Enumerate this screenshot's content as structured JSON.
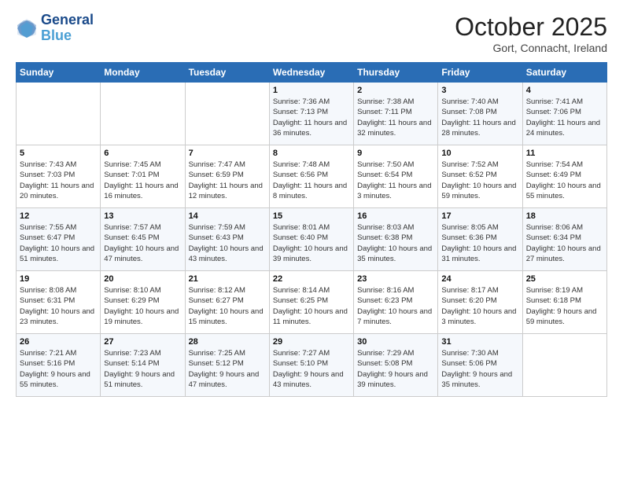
{
  "header": {
    "logo_line1": "General",
    "logo_line2": "Blue",
    "month_title": "October 2025",
    "location": "Gort, Connacht, Ireland"
  },
  "days_of_week": [
    "Sunday",
    "Monday",
    "Tuesday",
    "Wednesday",
    "Thursday",
    "Friday",
    "Saturday"
  ],
  "weeks": [
    [
      {
        "num": "",
        "info": ""
      },
      {
        "num": "",
        "info": ""
      },
      {
        "num": "",
        "info": ""
      },
      {
        "num": "1",
        "info": "Sunrise: 7:36 AM\nSunset: 7:13 PM\nDaylight: 11 hours\nand 36 minutes."
      },
      {
        "num": "2",
        "info": "Sunrise: 7:38 AM\nSunset: 7:11 PM\nDaylight: 11 hours\nand 32 minutes."
      },
      {
        "num": "3",
        "info": "Sunrise: 7:40 AM\nSunset: 7:08 PM\nDaylight: 11 hours\nand 28 minutes."
      },
      {
        "num": "4",
        "info": "Sunrise: 7:41 AM\nSunset: 7:06 PM\nDaylight: 11 hours\nand 24 minutes."
      }
    ],
    [
      {
        "num": "5",
        "info": "Sunrise: 7:43 AM\nSunset: 7:03 PM\nDaylight: 11 hours\nand 20 minutes."
      },
      {
        "num": "6",
        "info": "Sunrise: 7:45 AM\nSunset: 7:01 PM\nDaylight: 11 hours\nand 16 minutes."
      },
      {
        "num": "7",
        "info": "Sunrise: 7:47 AM\nSunset: 6:59 PM\nDaylight: 11 hours\nand 12 minutes."
      },
      {
        "num": "8",
        "info": "Sunrise: 7:48 AM\nSunset: 6:56 PM\nDaylight: 11 hours\nand 8 minutes."
      },
      {
        "num": "9",
        "info": "Sunrise: 7:50 AM\nSunset: 6:54 PM\nDaylight: 11 hours\nand 3 minutes."
      },
      {
        "num": "10",
        "info": "Sunrise: 7:52 AM\nSunset: 6:52 PM\nDaylight: 10 hours\nand 59 minutes."
      },
      {
        "num": "11",
        "info": "Sunrise: 7:54 AM\nSunset: 6:49 PM\nDaylight: 10 hours\nand 55 minutes."
      }
    ],
    [
      {
        "num": "12",
        "info": "Sunrise: 7:55 AM\nSunset: 6:47 PM\nDaylight: 10 hours\nand 51 minutes."
      },
      {
        "num": "13",
        "info": "Sunrise: 7:57 AM\nSunset: 6:45 PM\nDaylight: 10 hours\nand 47 minutes."
      },
      {
        "num": "14",
        "info": "Sunrise: 7:59 AM\nSunset: 6:43 PM\nDaylight: 10 hours\nand 43 minutes."
      },
      {
        "num": "15",
        "info": "Sunrise: 8:01 AM\nSunset: 6:40 PM\nDaylight: 10 hours\nand 39 minutes."
      },
      {
        "num": "16",
        "info": "Sunrise: 8:03 AM\nSunset: 6:38 PM\nDaylight: 10 hours\nand 35 minutes."
      },
      {
        "num": "17",
        "info": "Sunrise: 8:05 AM\nSunset: 6:36 PM\nDaylight: 10 hours\nand 31 minutes."
      },
      {
        "num": "18",
        "info": "Sunrise: 8:06 AM\nSunset: 6:34 PM\nDaylight: 10 hours\nand 27 minutes."
      }
    ],
    [
      {
        "num": "19",
        "info": "Sunrise: 8:08 AM\nSunset: 6:31 PM\nDaylight: 10 hours\nand 23 minutes."
      },
      {
        "num": "20",
        "info": "Sunrise: 8:10 AM\nSunset: 6:29 PM\nDaylight: 10 hours\nand 19 minutes."
      },
      {
        "num": "21",
        "info": "Sunrise: 8:12 AM\nSunset: 6:27 PM\nDaylight: 10 hours\nand 15 minutes."
      },
      {
        "num": "22",
        "info": "Sunrise: 8:14 AM\nSunset: 6:25 PM\nDaylight: 10 hours\nand 11 minutes."
      },
      {
        "num": "23",
        "info": "Sunrise: 8:16 AM\nSunset: 6:23 PM\nDaylight: 10 hours\nand 7 minutes."
      },
      {
        "num": "24",
        "info": "Sunrise: 8:17 AM\nSunset: 6:20 PM\nDaylight: 10 hours\nand 3 minutes."
      },
      {
        "num": "25",
        "info": "Sunrise: 8:19 AM\nSunset: 6:18 PM\nDaylight: 9 hours\nand 59 minutes."
      }
    ],
    [
      {
        "num": "26",
        "info": "Sunrise: 7:21 AM\nSunset: 5:16 PM\nDaylight: 9 hours\nand 55 minutes."
      },
      {
        "num": "27",
        "info": "Sunrise: 7:23 AM\nSunset: 5:14 PM\nDaylight: 9 hours\nand 51 minutes."
      },
      {
        "num": "28",
        "info": "Sunrise: 7:25 AM\nSunset: 5:12 PM\nDaylight: 9 hours\nand 47 minutes."
      },
      {
        "num": "29",
        "info": "Sunrise: 7:27 AM\nSunset: 5:10 PM\nDaylight: 9 hours\nand 43 minutes."
      },
      {
        "num": "30",
        "info": "Sunrise: 7:29 AM\nSunset: 5:08 PM\nDaylight: 9 hours\nand 39 minutes."
      },
      {
        "num": "31",
        "info": "Sunrise: 7:30 AM\nSunset: 5:06 PM\nDaylight: 9 hours\nand 35 minutes."
      },
      {
        "num": "",
        "info": ""
      }
    ]
  ]
}
